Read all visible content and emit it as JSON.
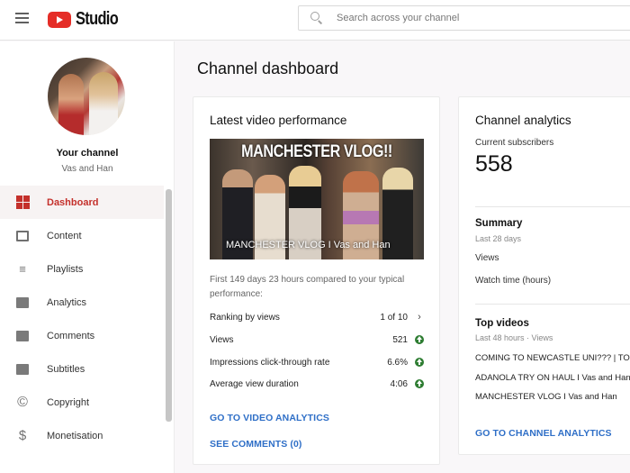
{
  "header": {
    "menu_icon": "hamburger-menu-icon",
    "logo_icon": "youtube-play-icon",
    "logo_text": "Studio",
    "search": {
      "icon": "search-icon",
      "placeholder": "Search across your channel",
      "value": ""
    }
  },
  "sidebar": {
    "avatar_alt": "channel avatar",
    "your_channel_label": "Your channel",
    "channel_name": "Vas and Han",
    "items": [
      {
        "label": "Dashboard",
        "icon": "dashboard-icon",
        "active": true
      },
      {
        "label": "Content",
        "icon": "content-icon",
        "active": false
      },
      {
        "label": "Playlists",
        "icon": "playlists-icon",
        "active": false
      },
      {
        "label": "Analytics",
        "icon": "analytics-icon",
        "active": false
      },
      {
        "label": "Comments",
        "icon": "comments-icon",
        "active": false
      },
      {
        "label": "Subtitles",
        "icon": "subtitles-icon",
        "active": false
      },
      {
        "label": "Copyright",
        "icon": "copyright-icon",
        "active": false
      },
      {
        "label": "Monetisation",
        "icon": "dollar-icon",
        "active": false
      }
    ]
  },
  "main": {
    "page_title": "Channel dashboard",
    "latest_video": {
      "title": "Latest video performance",
      "thumbnail_overlay": "MANCHESTER VLOG!!",
      "video_title": "MANCHESTER VLOG I Vas and Han",
      "comparison_note": "First 149 days 23 hours compared to your typical performance:",
      "metrics": [
        {
          "label": "Ranking by views",
          "value": "1 of 10",
          "indicator": "chevron-right"
        },
        {
          "label": "Views",
          "value": "521",
          "indicator": "up-arrow"
        },
        {
          "label": "Impressions click-through rate",
          "value": "6.6%",
          "indicator": "up-arrow"
        },
        {
          "label": "Average view duration",
          "value": "4:06",
          "indicator": "up-arrow"
        }
      ],
      "link_analytics": "GO TO VIDEO ANALYTICS",
      "link_comments": "SEE COMMENTS (0)"
    },
    "channel_analytics": {
      "title": "Channel analytics",
      "subscribers_label": "Current subscribers",
      "subscribers_value": "558",
      "summary_title": "Summary",
      "summary_period": "Last 28 days",
      "summary_rows": [
        "Views",
        "Watch time (hours)"
      ],
      "top_videos_title": "Top videos",
      "top_videos_period": "Last 48 hours · Views",
      "top_videos": [
        "COMING TO NEWCASTLE UNI??? | TOP",
        "ADANOLA TRY ON HAUL I Vas and Han",
        "MANCHESTER VLOG I Vas and Han"
      ],
      "link_channel_analytics": "GO TO CHANNEL ANALYTICS"
    }
  },
  "colors": {
    "accent_red": "#c4302b",
    "link_blue": "#2f6fc7",
    "positive_green": "#2e7d32",
    "logo_red": "#e52d27"
  }
}
